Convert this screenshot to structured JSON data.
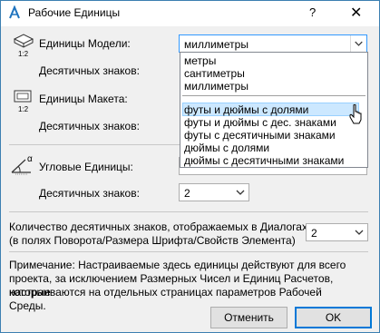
{
  "window": {
    "title": "Рабочие Единицы",
    "help": "?",
    "close": "✕"
  },
  "model_units": {
    "label": "Единицы Модели:",
    "value": "миллиметры",
    "decimals_label": "Десятичных знаков:"
  },
  "layout_units": {
    "label": "Единицы Макета:",
    "decimals_label": "Десятичных знаков:"
  },
  "angle_units": {
    "label": "Угловые Единицы:",
    "decimals_label": "Десятичных знаков:",
    "decimals_value": "2"
  },
  "dropdown": {
    "items": [
      "метры",
      "сантиметры",
      "миллиметры",
      "футы и дюймы с долями",
      "футы и дюймы с дес. знаками",
      "футы с десятичными знаками",
      "дюймы с долями",
      "дюймы с десятичными знаками"
    ],
    "highlighted_index": 3
  },
  "dialog_decimals": {
    "label_line1": "Количество десятичных знаков, отображаемых в Диалогах:",
    "label_line2": "(в полях Поворота/Размера Шрифта/Свойств Элемента)",
    "value": "2"
  },
  "note": {
    "line1": "Примечание: Настраиваемые здесь единицы действуют для всего",
    "line2": "проекта, за исключением Размерных Чисел и Единиц Расчетов, которые",
    "line3": "настраиваются на отдельных страницах параметров Рабочей Среды."
  },
  "buttons": {
    "cancel": "Отменить",
    "ok": "OK"
  },
  "icons": {
    "app": "archicad-icon",
    "model": "model-units-icon",
    "layout": "layout-units-icon",
    "angle": "angle-units-icon",
    "icon_caption": "1:2",
    "angle_symbol": "α"
  },
  "colors": {
    "accent": "#3399ff",
    "highlight": "#cce8ff",
    "default_button_border": "#0078d7"
  }
}
